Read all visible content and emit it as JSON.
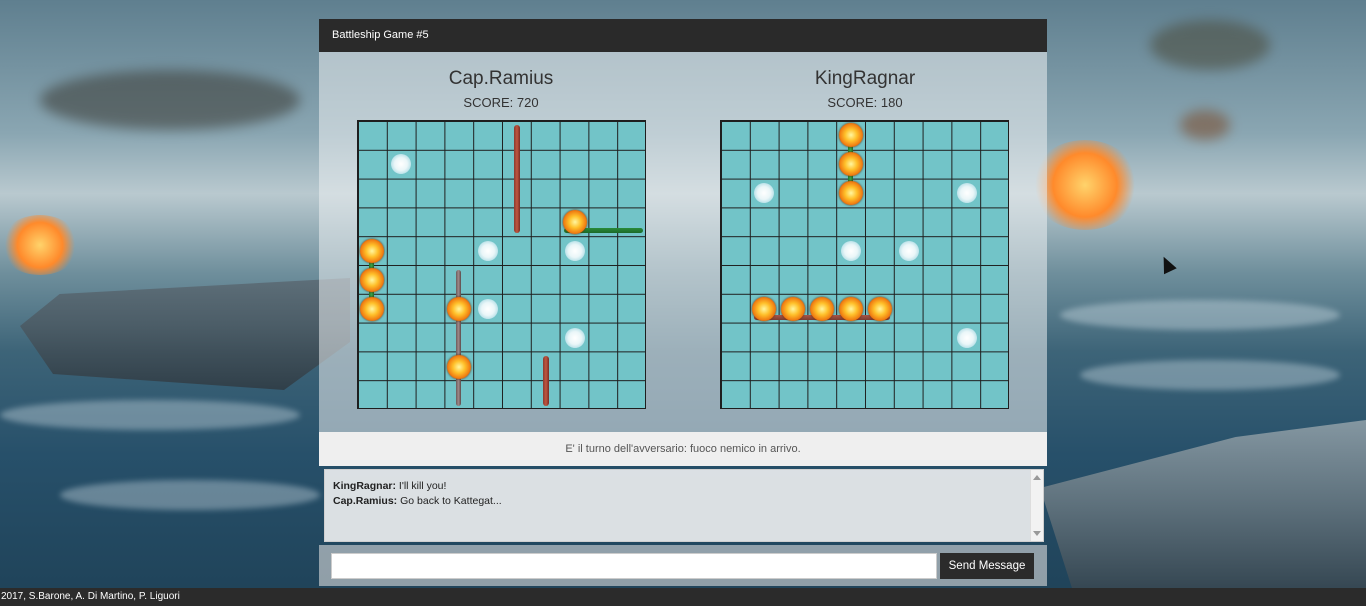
{
  "window": {
    "title": "Battleship Game #5"
  },
  "players": [
    {
      "name": "Cap.Ramius",
      "score": "SCORE: 720"
    },
    {
      "name": "KingRagnar",
      "score": "SCORE: 180"
    }
  ],
  "boards": {
    "size": 10,
    "left": {
      "ships": [
        {
          "dir": "v",
          "col": 5,
          "row": 0,
          "len": 4,
          "style": "v"
        },
        {
          "dir": "h",
          "col": 7,
          "row": 3,
          "len": 3,
          "style": "hg"
        },
        {
          "dir": "v",
          "col": 0,
          "row": 4,
          "len": 3,
          "style": "vg"
        },
        {
          "dir": "v",
          "col": 3,
          "row": 5,
          "len": 5,
          "style": "vgray"
        },
        {
          "dir": "v",
          "col": 6,
          "row": 8,
          "len": 2,
          "style": "v"
        }
      ],
      "hits": [
        [
          7,
          3
        ],
        [
          0,
          4
        ],
        [
          0,
          5
        ],
        [
          0,
          6
        ],
        [
          3,
          6
        ],
        [
          3,
          8
        ]
      ],
      "misses": [
        [
          1,
          1
        ],
        [
          4,
          4
        ],
        [
          7,
          4
        ],
        [
          4,
          6
        ],
        [
          7,
          7
        ]
      ]
    },
    "right": {
      "ships": [
        {
          "dir": "v",
          "col": 4,
          "row": 0,
          "len": 3,
          "style": "vg"
        },
        {
          "dir": "h",
          "col": 1,
          "row": 6,
          "len": 5,
          "style": "hr"
        }
      ],
      "hits": [
        [
          4,
          0
        ],
        [
          4,
          1
        ],
        [
          4,
          2
        ],
        [
          1,
          6
        ],
        [
          2,
          6
        ],
        [
          3,
          6
        ],
        [
          4,
          6
        ],
        [
          5,
          6
        ]
      ],
      "misses": [
        [
          1,
          2
        ],
        [
          8,
          2
        ],
        [
          4,
          4
        ],
        [
          6,
          4
        ],
        [
          8,
          7
        ]
      ]
    }
  },
  "status": {
    "text": "E' il turno dell'avversario: fuoco nemico in arrivo."
  },
  "chat": {
    "messages": [
      {
        "author": "KingRagnar:",
        "text": "I'll kill you!"
      },
      {
        "author": "Cap.Ramius:",
        "text": "Go back to Kattegat..."
      }
    ],
    "input_value": "",
    "send_label": "Send Message"
  },
  "footer": {
    "text": "2017, S.Barone, A. Di Martino, P. Liguori"
  }
}
